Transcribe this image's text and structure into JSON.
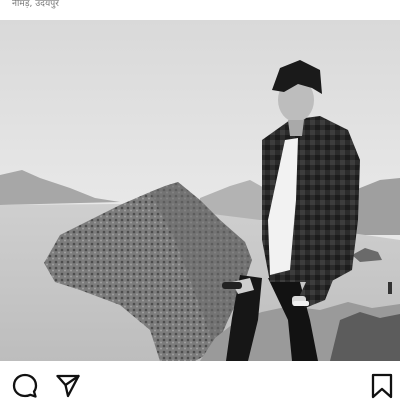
{
  "post": {
    "location": "नीमड़, उदयपुर",
    "photo": {
      "description": "black-and-white-landscape",
      "style": "grayscale"
    }
  },
  "actions": {
    "comment_icon": "comment-icon",
    "share_icon": "share-icon",
    "save_icon": "bookmark-icon"
  },
  "colors": {
    "background": "#ffffff",
    "icon": "#111111",
    "location_text": "#777777"
  }
}
